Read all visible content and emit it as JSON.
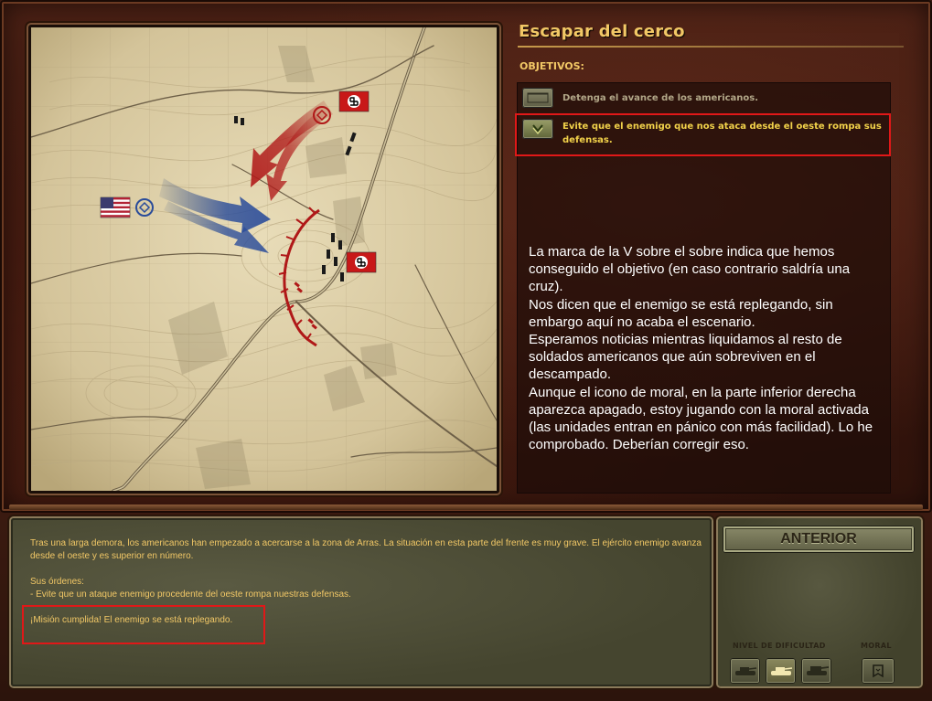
{
  "mission": {
    "title": "Escapar del cerco",
    "objectives_header": "OBJETIVOS:"
  },
  "objectives": [
    {
      "text": "Detenga el avance de los americanos.",
      "completed": false
    },
    {
      "text": "Evite que el enemigo que nos ataca desde el oeste rompa sus defensas.",
      "completed": true
    }
  ],
  "annotation": "La marca de la V sobre el sobre indica que hemos conseguido el objetivo (en caso contrario saldría una cruz).\nNos dicen que el enemigo se está replegando, sin embargo aquí no acaba el escenario.\nEsperamos noticias mientras liquidamos al resto de soldados americanos que aún sobreviven en el descampado.\nAunque el icono de moral, en la parte inferior derecha aparezca apagado, estoy jugando con la moral activada (las unidades entran en pánico con más facilidad). Lo he comprobado. Deberían corregir eso.",
  "briefing": {
    "paragraph1": "Tras una larga demora, los americanos han empezado a acercarse a la zona de Arras. La situación en esta parte del frente es muy grave. El ejército enemigo avanza desde el oeste y es superior en número.",
    "orders_title": "Sus órdenes:",
    "orders_item": "- Evite que un ataque enemigo procedente del oeste rompa nuestras defensas.",
    "status": "¡Misión cumplida! El enemigo se está replegando."
  },
  "controls": {
    "back_button": "ANTERIOR",
    "difficulty_label": "NIVEL DE DIFICULTAD",
    "difficulty_levels": [
      "tank-easy-icon",
      "tank-medium-icon",
      "tank-hard-icon"
    ],
    "difficulty_selected_index": 1,
    "morale_label": "MORAL",
    "morale_enabled": false
  },
  "colors": {
    "title": "#f2c866",
    "completed_objective": "#f2d24a",
    "pending_objective": "#b2a788",
    "highlight_box": "#e01818",
    "american_arrow": "#2c4c8c",
    "german_arrow": "#b01818"
  }
}
